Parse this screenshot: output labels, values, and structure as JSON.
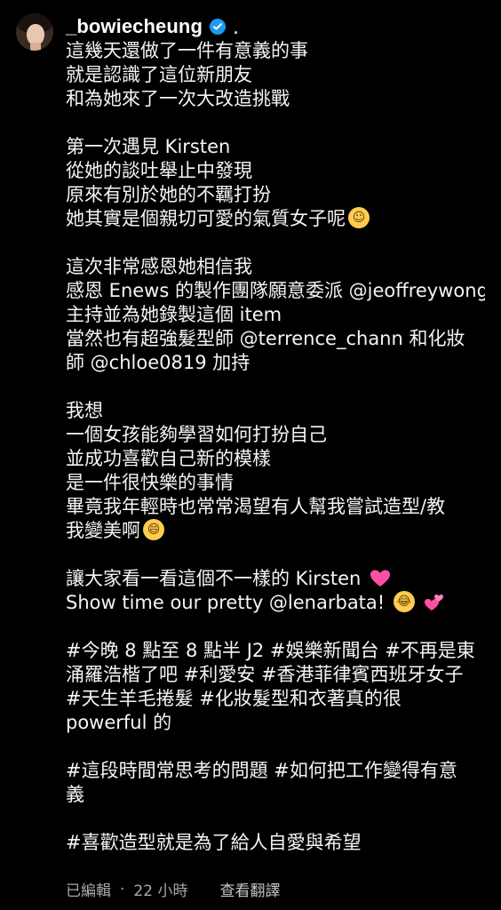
{
  "post": {
    "username": "_bowiecheung",
    "separator_dot": ".",
    "lines": [
      "這幾天還做了一件有意義的事",
      "就是認識了這位新朋友",
      "和為她來了一次大改造挑戰",
      "",
      "第一次遇見 Kirsten",
      "從她的談吐舉止中發現",
      "原來有別於她的不羈打扮",
      "她其實是個親切可愛的氣質女子呢",
      "",
      "這次非常感恩她相信我",
      "感恩 Enews 的製作團隊願意委派 @jeoffreywong",
      "主持並為她錄製這個 item",
      "當然也有超強髮型師 @terrence_chann 和化妝",
      "師 @chloe0819 加持",
      "",
      "我想",
      "一個女孩能夠學習如何打扮自己",
      "並成功喜歡自己新的模樣",
      "是一件很快樂的事情",
      "畢竟我年輕時也常常渴望有人幫我嘗試造型/教",
      "我變美啊",
      "",
      "讓大家看一看這個不一樣的 Kirsten",
      "Show time our pretty @lenarbata!",
      "",
      "#今晚 8 點至 8 點半 J2 #娛樂新聞台 #不再是東",
      "涌羅浩楷了吧 #利愛安 #香港菲律賓西班牙女子",
      "#天生羊毛捲髮 #化妝髮型和衣著真的很",
      "powerful 的",
      "",
      "#這段時間常思考的問題 #如何把工作變得有意",
      "義",
      "",
      "#喜歡造型就是為了給人自愛與希望"
    ]
  },
  "meta": {
    "edited": "已編輯",
    "dot": "·",
    "time": "22 小時",
    "translate": "查看翻譯"
  },
  "emojis": {
    "l7": "smiling-face-with-hearts",
    "l20": "rolling-on-floor-laughing",
    "l22": "beating-heart",
    "l23a": "tears-of-joy",
    "l23b": "two-hearts"
  },
  "colors": {
    "verified": "#1d9bf0",
    "background": "#000000",
    "meta": "#a8a8a8"
  }
}
